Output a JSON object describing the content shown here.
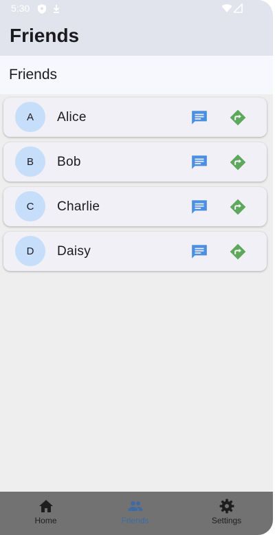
{
  "status_bar": {
    "time": "5:30"
  },
  "app_bar": {
    "title": "Friends"
  },
  "section": {
    "title": "Friends"
  },
  "friends": [
    {
      "initial": "A",
      "name": "Alice"
    },
    {
      "initial": "B",
      "name": "Bob"
    },
    {
      "initial": "C",
      "name": "Charlie"
    },
    {
      "initial": "D",
      "name": "Daisy"
    }
  ],
  "icons": {
    "message": "message-icon",
    "directions": "directions-icon"
  },
  "bottom_nav": {
    "items": [
      {
        "label": "Home",
        "icon": "home-icon",
        "active": false
      },
      {
        "label": "Friends",
        "icon": "people-icon",
        "active": true
      },
      {
        "label": "Settings",
        "icon": "gear-icon",
        "active": false
      }
    ]
  },
  "colors": {
    "app_bar": "#e1e4ec",
    "avatar": "#c6def9",
    "message_icon": "#4a8fe2",
    "directions_icon": "#5da85c",
    "nav_active": "#3f6aa6"
  }
}
